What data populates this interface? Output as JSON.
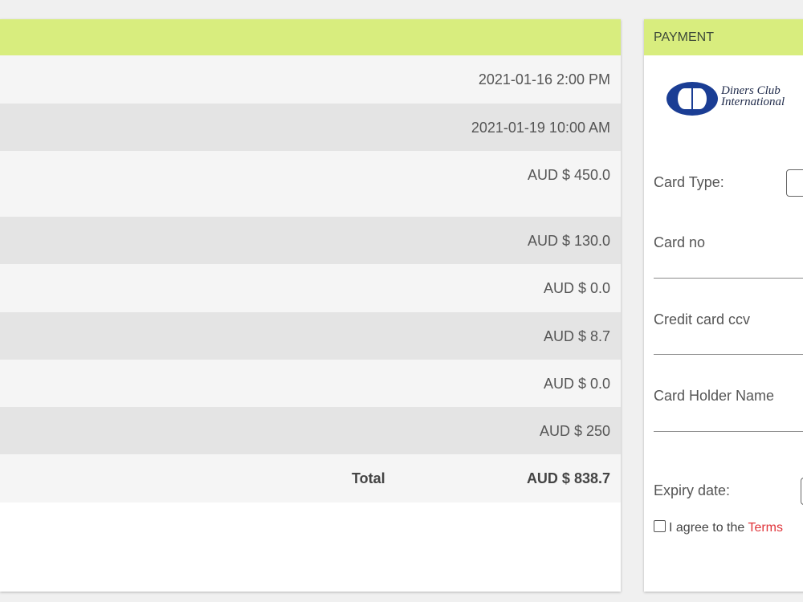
{
  "summary": {
    "rows": [
      {
        "value": "2021-01-16 2:00 PM"
      },
      {
        "value": "2021-01-19 10:00 AM"
      },
      {
        "value": "AUD $ 450.0"
      },
      {
        "value": "AUD $ 130.0"
      },
      {
        "value": "AUD $ 0.0"
      },
      {
        "value": "AUD $ 8.7"
      },
      {
        "value": "AUD $ 0.0"
      },
      {
        "value": "AUD $ 250"
      }
    ],
    "total": {
      "label": "Total",
      "value": "AUD $ 838.7"
    }
  },
  "payment": {
    "header": "PAYMENT",
    "logo": {
      "line1": "Diners Club",
      "line2": "International"
    },
    "card_type_label": "Card Type:",
    "card_no_label": "Card no",
    "ccv_label": "Credit card ccv",
    "holder_label": "Card Holder Name",
    "expiry_label": "Expiry date:",
    "agree_text": "I agree to the ",
    "terms_text": "Terms"
  },
  "colors": {
    "header_accent": "#d8ed7e",
    "terms_link": "#e0343a"
  }
}
